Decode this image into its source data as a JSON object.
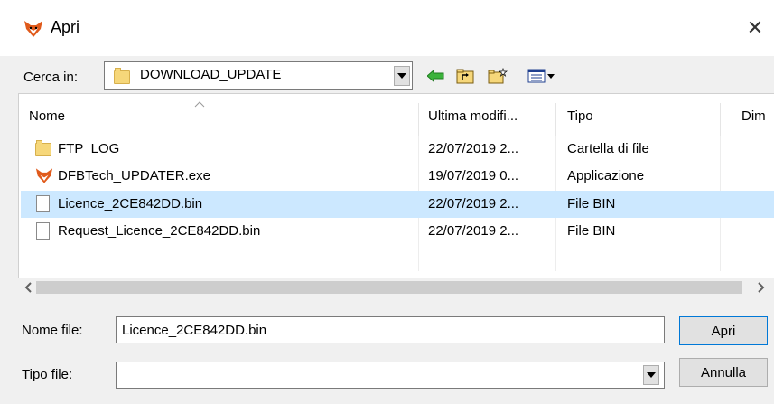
{
  "window": {
    "title": "Apri",
    "close_glyph": "✕"
  },
  "lookin": {
    "label": "Cerca in:",
    "value": "DOWNLOAD_UPDATE"
  },
  "list": {
    "headers": {
      "name": "Nome",
      "modified": "Ultima modifi...",
      "type": "Tipo",
      "size": "Dim"
    },
    "rows": [
      {
        "name": "FTP_LOG",
        "modified": "22/07/2019 2...",
        "type": "Cartella di file",
        "icon": "folder-icon"
      },
      {
        "name": "DFBTech_UPDATER.exe",
        "modified": "19/07/2019 0...",
        "type": "Applicazione",
        "icon": "fox-app-icon"
      },
      {
        "name": "Licence_2CE842DD.bin",
        "modified": "22/07/2019 2...",
        "type": "File BIN",
        "icon": "file-icon",
        "selected": true
      },
      {
        "name": "Request_Licence_2CE842DD.bin",
        "modified": "22/07/2019 2...",
        "type": "File BIN",
        "icon": "file-icon"
      }
    ]
  },
  "filename": {
    "label": "Nome file:",
    "value": "Licence_2CE842DD.bin"
  },
  "filetype": {
    "label": "Tipo file:",
    "value": ""
  },
  "buttons": {
    "open": "Apri",
    "cancel": "Annulla"
  },
  "colors": {
    "selection": "#cce8ff",
    "folder": "#f6d77a",
    "accent": "#0078d7"
  }
}
